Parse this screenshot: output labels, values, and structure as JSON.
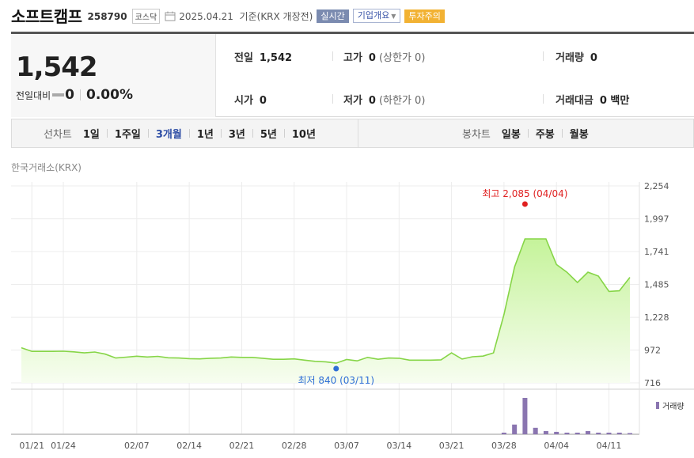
{
  "header": {
    "name": "소프트캠프",
    "code": "258790",
    "market": "코스닥",
    "date_text": "2025.04.21  기준(KRX 개장전)",
    "realtime_label": "실시간",
    "corp_overview_label": "기업개요",
    "warning_label": "투자주의"
  },
  "summary": {
    "price": "1,542",
    "change_label": "전일대비",
    "change_value": "0",
    "change_pct": "0.00%",
    "prev_close_label": "전일",
    "prev_close": "1,542",
    "high_label": "고가",
    "high": "0",
    "high_limit_text": "(상한가 0)",
    "volume_label": "거래량",
    "volume": "0",
    "open_label": "시가",
    "open": "0",
    "low_label": "저가",
    "low": "0",
    "low_limit_text": "(하한가 0)",
    "amount_label": "거래대금",
    "amount": "0 백만"
  },
  "periods": {
    "line_title": "선차트",
    "line_items": [
      "1일",
      "1주일",
      "3개월",
      "1년",
      "3년",
      "5년",
      "10년"
    ],
    "active": "3개월",
    "candle_title": "봉차트",
    "candle_items": [
      "일봉",
      "주봉",
      "월봉"
    ]
  },
  "exchange_label": "한국거래소(KRX)",
  "chart_data": {
    "type": "area",
    "y_ticks": [
      "2,254",
      "1,997",
      "1,741",
      "1,485",
      "1,228",
      "972",
      "716"
    ],
    "y_tick_values": [
      2254,
      1997,
      1741,
      1485,
      1228,
      972,
      716
    ],
    "ylim": [
      716,
      2254
    ],
    "x_tick_labels": [
      "01/21",
      "01/24",
      "02/07",
      "02/14",
      "02/21",
      "02/28",
      "03/07",
      "03/14",
      "03/21",
      "03/28",
      "04/04",
      "04/11"
    ],
    "x_tick_index": [
      1,
      4,
      11,
      16,
      21,
      26,
      31,
      36,
      41,
      46,
      51,
      56
    ],
    "price_series": [
      990,
      962,
      962,
      962,
      963,
      958,
      950,
      957,
      940,
      910,
      917,
      924,
      918,
      923,
      912,
      910,
      905,
      903,
      908,
      910,
      918,
      915,
      915,
      908,
      900,
      900,
      903,
      893,
      884,
      880,
      870,
      898,
      888,
      915,
      900,
      910,
      908,
      893,
      893,
      893,
      896,
      950,
      902,
      920,
      925,
      950,
      1250,
      1620,
      1840,
      1840,
      1840,
      1640,
      1580,
      1500,
      1580,
      1550,
      1430,
      1435,
      1540
    ],
    "volume_series": [
      0,
      0,
      0,
      0,
      0,
      0,
      0,
      0,
      0,
      0,
      0,
      0,
      0,
      0,
      0,
      0,
      0,
      0,
      0,
      0,
      0,
      0,
      0,
      0,
      0,
      0,
      0,
      0,
      0,
      0,
      0,
      0,
      0,
      0,
      0,
      0,
      0,
      0,
      0,
      0,
      0,
      0,
      0,
      0,
      0,
      0,
      2,
      12,
      45,
      8,
      4,
      3,
      2,
      2,
      4,
      2,
      2,
      2,
      1
    ],
    "high_annotation": "최고 2,085 (04/04)",
    "low_annotation": "최저 840 (03/11)",
    "volume_legend": "거래량",
    "colors": {
      "line": "#86d547",
      "fill_top": "#c5f39a",
      "fill_bottom": "#f7fdf0",
      "high": "#e02020",
      "low": "#2f6fd6",
      "volume": "#8a75b0"
    }
  }
}
